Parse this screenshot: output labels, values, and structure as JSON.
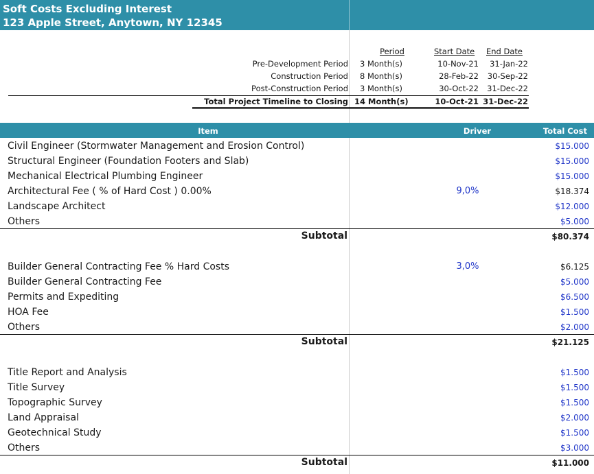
{
  "header": {
    "title": "Soft Costs Excluding Interest",
    "address": "123 Apple Street, Anytown, NY 12345"
  },
  "timeline": {
    "col_period": "Period",
    "col_start": "Start Date",
    "col_end": "End Date",
    "rows": [
      {
        "label": "Pre-Development Period",
        "period": "3 Month(s)",
        "start": "10-Nov-21",
        "end": "31-Jan-22"
      },
      {
        "label": "Construction Period",
        "period": "8 Month(s)",
        "start": "28-Feb-22",
        "end": "30-Sep-22"
      },
      {
        "label": "Post-Construction Period",
        "period": "3 Month(s)",
        "start": "30-Oct-22",
        "end": "31-Dec-22"
      }
    ],
    "total": {
      "label": "Total Project Timeline to Closing",
      "period": "14 Month(s)",
      "start": "10-Oct-21",
      "end": "31-Dec-22"
    }
  },
  "table": {
    "col_item": "Item",
    "col_driver": "Driver",
    "col_cost": "Total Cost",
    "groups": [
      {
        "items": [
          {
            "item": "Civil Engineer (Stormwater Management and Erosion Control)",
            "driver": "",
            "cost": "$15.000"
          },
          {
            "item": "Structural Engineer (Foundation Footers and Slab)",
            "driver": "",
            "cost": "$15.000"
          },
          {
            "item": "Mechanical Electrical Plumbing Engineer",
            "driver": "",
            "cost": "$15.000"
          },
          {
            "item": "Architectural Fee ( % of Hard Cost ) 0.00%",
            "driver": "9,0%",
            "cost": "$18.374"
          },
          {
            "item": "Landscape Architect",
            "driver": "",
            "cost": "$12.000"
          },
          {
            "item": "Others",
            "driver": "",
            "cost": "$5.000"
          }
        ],
        "subtotal_label": "Subtotal",
        "subtotal": "$80.374"
      },
      {
        "items": [
          {
            "item": "Builder General Contracting Fee % Hard Costs",
            "driver": "3,0%",
            "cost": "$6.125"
          },
          {
            "item": "Builder General Contracting Fee",
            "driver": "",
            "cost": "$5.000"
          },
          {
            "item": "Permits and Expediting",
            "driver": "",
            "cost": "$6.500"
          },
          {
            "item": "HOA Fee",
            "driver": "",
            "cost": "$1.500"
          },
          {
            "item": "Others",
            "driver": "",
            "cost": "$2.000"
          }
        ],
        "subtotal_label": "Subtotal",
        "subtotal": "$21.125"
      },
      {
        "items": [
          {
            "item": "Title Report and Analysis",
            "driver": "",
            "cost": "$1.500"
          },
          {
            "item": "Title Survey",
            "driver": "",
            "cost": "$1.500"
          },
          {
            "item": "Topographic Survey",
            "driver": "",
            "cost": "$1.500"
          },
          {
            "item": "Land Appraisal",
            "driver": "",
            "cost": "$2.000"
          },
          {
            "item": "Geotechnical Study",
            "driver": "",
            "cost": "$1.500"
          },
          {
            "item": "Others",
            "driver": "",
            "cost": "$3.000"
          }
        ],
        "subtotal_label": "Subtotal",
        "subtotal": "$11.000"
      }
    ]
  },
  "colors": {
    "accent": "#2e8fa8",
    "input_blue": "#1f35c8"
  }
}
